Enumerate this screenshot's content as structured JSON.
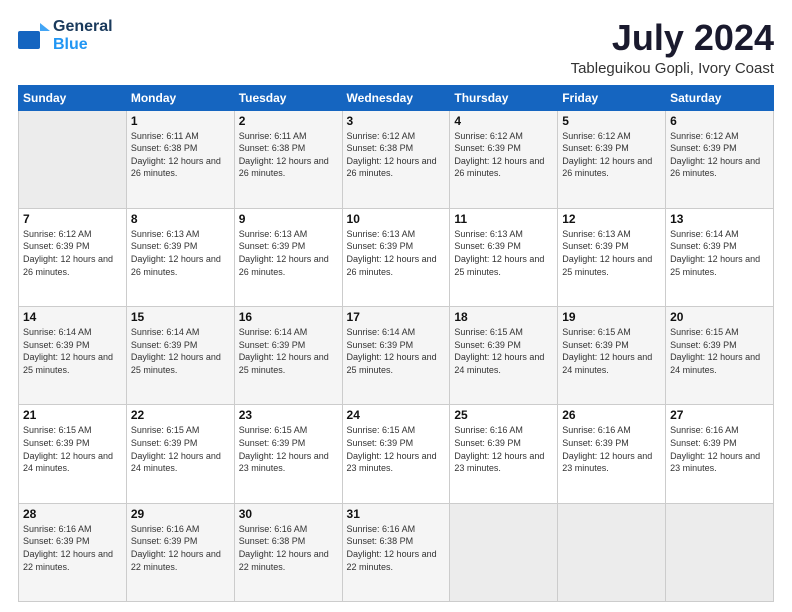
{
  "header": {
    "logo_line1": "General",
    "logo_line2": "Blue",
    "month": "July 2024",
    "location": "Tableguikou Gopli, Ivory Coast"
  },
  "days_of_week": [
    "Sunday",
    "Monday",
    "Tuesday",
    "Wednesday",
    "Thursday",
    "Friday",
    "Saturday"
  ],
  "weeks": [
    [
      {
        "num": "",
        "empty": true
      },
      {
        "num": "1",
        "sunrise": "Sunrise: 6:11 AM",
        "sunset": "Sunset: 6:38 PM",
        "daylight": "Daylight: 12 hours and 26 minutes."
      },
      {
        "num": "2",
        "sunrise": "Sunrise: 6:11 AM",
        "sunset": "Sunset: 6:38 PM",
        "daylight": "Daylight: 12 hours and 26 minutes."
      },
      {
        "num": "3",
        "sunrise": "Sunrise: 6:12 AM",
        "sunset": "Sunset: 6:38 PM",
        "daylight": "Daylight: 12 hours and 26 minutes."
      },
      {
        "num": "4",
        "sunrise": "Sunrise: 6:12 AM",
        "sunset": "Sunset: 6:39 PM",
        "daylight": "Daylight: 12 hours and 26 minutes."
      },
      {
        "num": "5",
        "sunrise": "Sunrise: 6:12 AM",
        "sunset": "Sunset: 6:39 PM",
        "daylight": "Daylight: 12 hours and 26 minutes."
      },
      {
        "num": "6",
        "sunrise": "Sunrise: 6:12 AM",
        "sunset": "Sunset: 6:39 PM",
        "daylight": "Daylight: 12 hours and 26 minutes."
      }
    ],
    [
      {
        "num": "7",
        "sunrise": "Sunrise: 6:12 AM",
        "sunset": "Sunset: 6:39 PM",
        "daylight": "Daylight: 12 hours and 26 minutes."
      },
      {
        "num": "8",
        "sunrise": "Sunrise: 6:13 AM",
        "sunset": "Sunset: 6:39 PM",
        "daylight": "Daylight: 12 hours and 26 minutes."
      },
      {
        "num": "9",
        "sunrise": "Sunrise: 6:13 AM",
        "sunset": "Sunset: 6:39 PM",
        "daylight": "Daylight: 12 hours and 26 minutes."
      },
      {
        "num": "10",
        "sunrise": "Sunrise: 6:13 AM",
        "sunset": "Sunset: 6:39 PM",
        "daylight": "Daylight: 12 hours and 26 minutes."
      },
      {
        "num": "11",
        "sunrise": "Sunrise: 6:13 AM",
        "sunset": "Sunset: 6:39 PM",
        "daylight": "Daylight: 12 hours and 25 minutes."
      },
      {
        "num": "12",
        "sunrise": "Sunrise: 6:13 AM",
        "sunset": "Sunset: 6:39 PM",
        "daylight": "Daylight: 12 hours and 25 minutes."
      },
      {
        "num": "13",
        "sunrise": "Sunrise: 6:14 AM",
        "sunset": "Sunset: 6:39 PM",
        "daylight": "Daylight: 12 hours and 25 minutes."
      }
    ],
    [
      {
        "num": "14",
        "sunrise": "Sunrise: 6:14 AM",
        "sunset": "Sunset: 6:39 PM",
        "daylight": "Daylight: 12 hours and 25 minutes."
      },
      {
        "num": "15",
        "sunrise": "Sunrise: 6:14 AM",
        "sunset": "Sunset: 6:39 PM",
        "daylight": "Daylight: 12 hours and 25 minutes."
      },
      {
        "num": "16",
        "sunrise": "Sunrise: 6:14 AM",
        "sunset": "Sunset: 6:39 PM",
        "daylight": "Daylight: 12 hours and 25 minutes."
      },
      {
        "num": "17",
        "sunrise": "Sunrise: 6:14 AM",
        "sunset": "Sunset: 6:39 PM",
        "daylight": "Daylight: 12 hours and 25 minutes."
      },
      {
        "num": "18",
        "sunrise": "Sunrise: 6:15 AM",
        "sunset": "Sunset: 6:39 PM",
        "daylight": "Daylight: 12 hours and 24 minutes."
      },
      {
        "num": "19",
        "sunrise": "Sunrise: 6:15 AM",
        "sunset": "Sunset: 6:39 PM",
        "daylight": "Daylight: 12 hours and 24 minutes."
      },
      {
        "num": "20",
        "sunrise": "Sunrise: 6:15 AM",
        "sunset": "Sunset: 6:39 PM",
        "daylight": "Daylight: 12 hours and 24 minutes."
      }
    ],
    [
      {
        "num": "21",
        "sunrise": "Sunrise: 6:15 AM",
        "sunset": "Sunset: 6:39 PM",
        "daylight": "Daylight: 12 hours and 24 minutes."
      },
      {
        "num": "22",
        "sunrise": "Sunrise: 6:15 AM",
        "sunset": "Sunset: 6:39 PM",
        "daylight": "Daylight: 12 hours and 24 minutes."
      },
      {
        "num": "23",
        "sunrise": "Sunrise: 6:15 AM",
        "sunset": "Sunset: 6:39 PM",
        "daylight": "Daylight: 12 hours and 23 minutes."
      },
      {
        "num": "24",
        "sunrise": "Sunrise: 6:15 AM",
        "sunset": "Sunset: 6:39 PM",
        "daylight": "Daylight: 12 hours and 23 minutes."
      },
      {
        "num": "25",
        "sunrise": "Sunrise: 6:16 AM",
        "sunset": "Sunset: 6:39 PM",
        "daylight": "Daylight: 12 hours and 23 minutes."
      },
      {
        "num": "26",
        "sunrise": "Sunrise: 6:16 AM",
        "sunset": "Sunset: 6:39 PM",
        "daylight": "Daylight: 12 hours and 23 minutes."
      },
      {
        "num": "27",
        "sunrise": "Sunrise: 6:16 AM",
        "sunset": "Sunset: 6:39 PM",
        "daylight": "Daylight: 12 hours and 23 minutes."
      }
    ],
    [
      {
        "num": "28",
        "sunrise": "Sunrise: 6:16 AM",
        "sunset": "Sunset: 6:39 PM",
        "daylight": "Daylight: 12 hours and 22 minutes."
      },
      {
        "num": "29",
        "sunrise": "Sunrise: 6:16 AM",
        "sunset": "Sunset: 6:39 PM",
        "daylight": "Daylight: 12 hours and 22 minutes."
      },
      {
        "num": "30",
        "sunrise": "Sunrise: 6:16 AM",
        "sunset": "Sunset: 6:38 PM",
        "daylight": "Daylight: 12 hours and 22 minutes."
      },
      {
        "num": "31",
        "sunrise": "Sunrise: 6:16 AM",
        "sunset": "Sunset: 6:38 PM",
        "daylight": "Daylight: 12 hours and 22 minutes."
      },
      {
        "num": "",
        "empty": true
      },
      {
        "num": "",
        "empty": true
      },
      {
        "num": "",
        "empty": true
      }
    ]
  ]
}
